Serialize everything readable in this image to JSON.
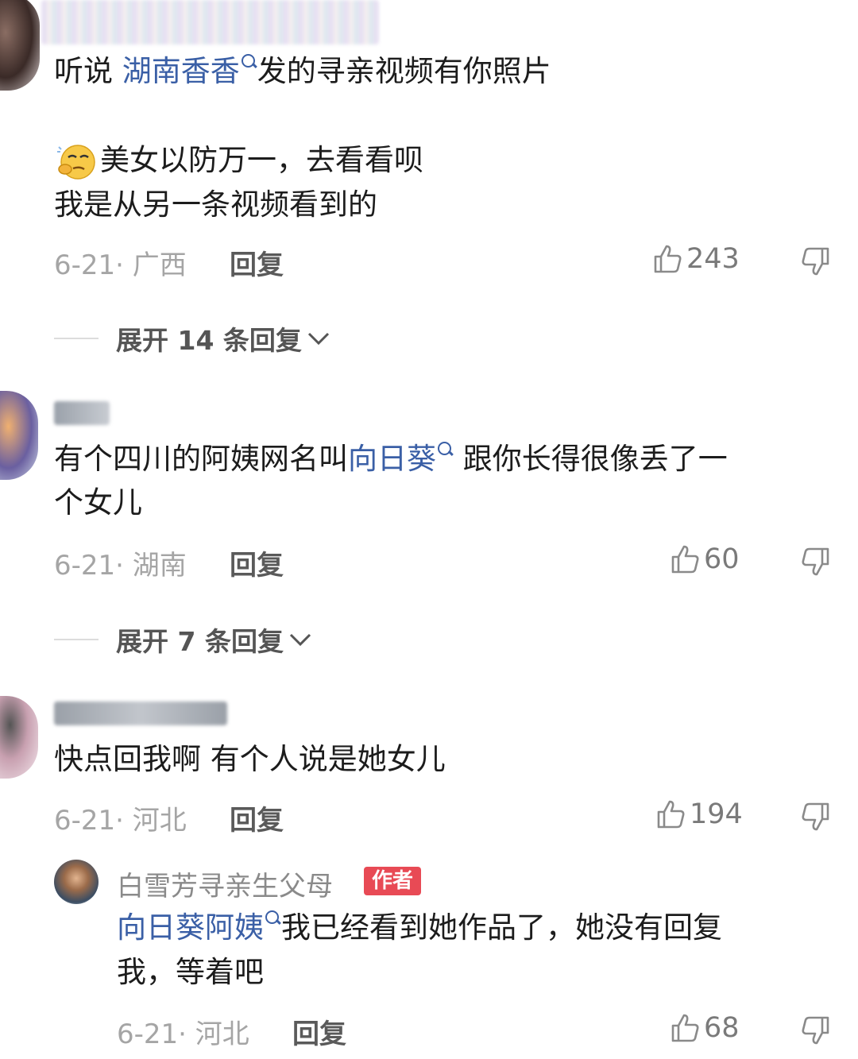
{
  "comments": [
    {
      "text_before": "听说 ",
      "mention": "湖南香香",
      "text_after": "发的寻亲视频有你照片",
      "line2": "美女以防万一，去看看呗",
      "line3": "我是从另一条视频看到的",
      "date": "6-21·",
      "location": "广西",
      "reply": "回复",
      "likes": "243",
      "expand": "展开 14 条回复",
      "emoji": "thinking-face"
    },
    {
      "text_before": "有个四川的阿姨网名叫",
      "mention": "向日葵",
      "text_after": " 跟你长得很像丢了一",
      "line2": "个女儿",
      "date": "6-21·",
      "location": "湖南",
      "reply": "回复",
      "likes": "60",
      "expand": "展开 7 条回复"
    },
    {
      "text": "快点回我啊 有个人说是她女儿",
      "date": "6-21·",
      "location": "河北",
      "reply": "回复",
      "likes": "194"
    }
  ],
  "author_reply": {
    "name": "白雪芳寻亲生父母",
    "badge": "作者",
    "mention": "向日葵阿姨",
    "text_after": "我已经看到她作品了，她没有回复",
    "line2": "我，等着吧",
    "date": "6-21·",
    "location": "河北",
    "reply": "回复",
    "likes": "68"
  },
  "colors": {
    "link": "#3a5fa6",
    "badge": "#e84a55",
    "meta": "#a5a5a5"
  }
}
